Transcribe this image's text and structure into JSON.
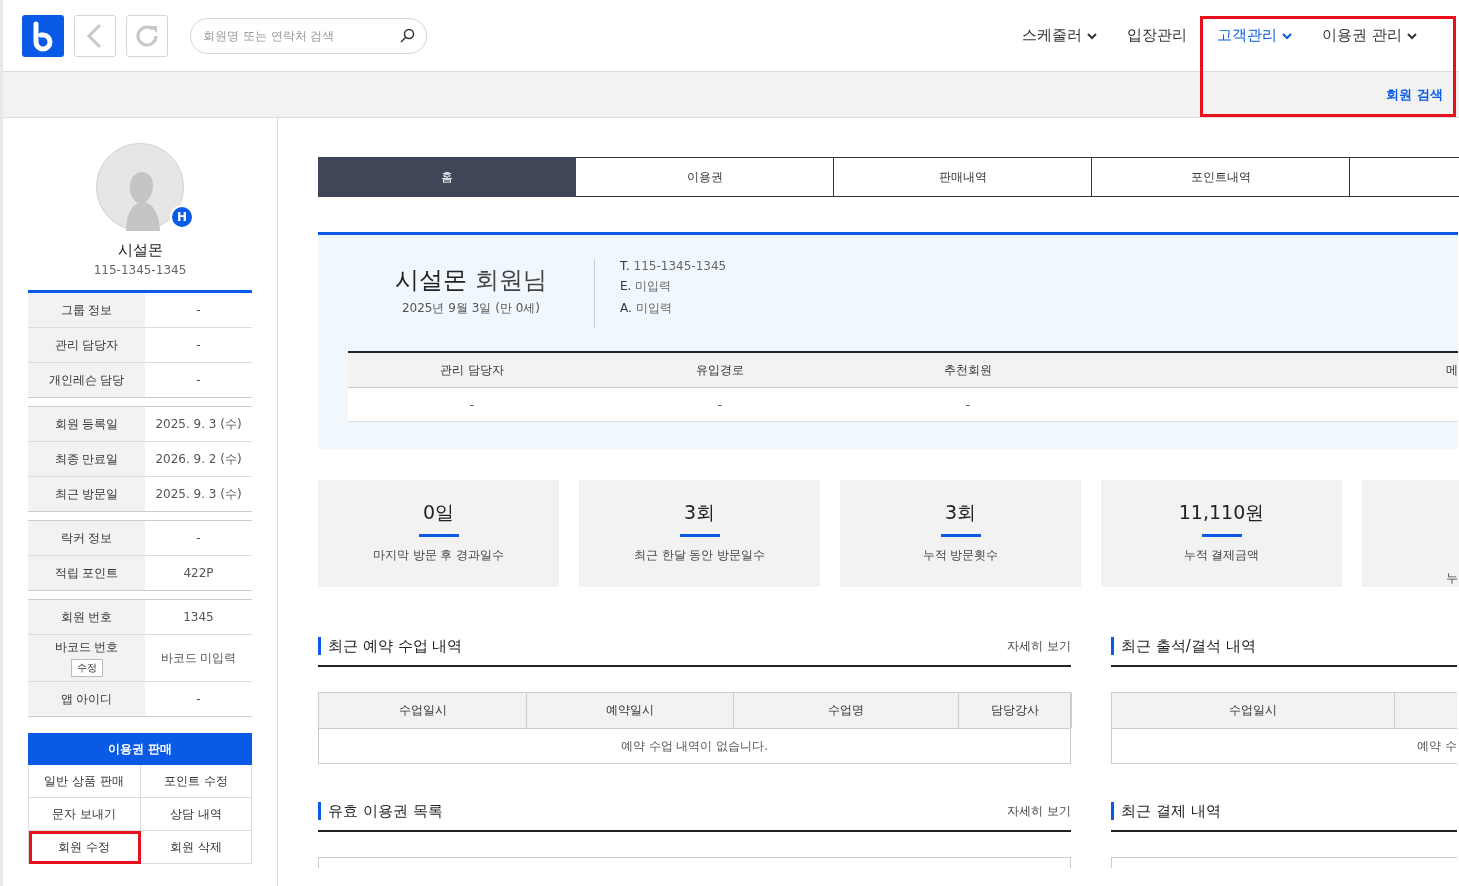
{
  "header": {
    "search": {
      "placeholder": "회원명 또는 연락처 검색"
    },
    "nav": [
      {
        "label": "스케줄러",
        "dropdown": true,
        "selected": false
      },
      {
        "label": "입장관리",
        "dropdown": false,
        "selected": false
      },
      {
        "label": "고객관리",
        "dropdown": true,
        "selected": true
      },
      {
        "label": "이용권 관리",
        "dropdown": true,
        "selected": false
      }
    ],
    "submenu": {
      "highlighted": true,
      "items": [
        {
          "label": "회원 검색",
          "selected": true
        }
      ]
    }
  },
  "member": {
    "badge": "H",
    "name": "시설몬",
    "phone": "115-1345-1345",
    "info_groups": [
      [
        {
          "label": "그룹 정보",
          "value": "-"
        },
        {
          "label": "관리 담당자",
          "value": "-"
        },
        {
          "label": "개인레슨 담당",
          "value": "-"
        }
      ],
      [
        {
          "label": "회원 등록일",
          "value": "2025. 9. 3 (수)"
        },
        {
          "label": "최종 만료일",
          "value": "2026. 9. 2 (수)"
        },
        {
          "label": "최근 방문일",
          "value": "2025. 9. 3 (수)"
        }
      ],
      [
        {
          "label": "락커 정보",
          "value": "-"
        },
        {
          "label": "적립 포인트",
          "value": "422P"
        }
      ],
      [
        {
          "label": "회원 번호",
          "value": "1345"
        },
        {
          "label": "바코드 번호",
          "value": "바코드 미입력",
          "action": "수정"
        },
        {
          "label": "앱 아이디",
          "value": "-"
        }
      ]
    ],
    "primary_action": "이용권 판매",
    "actions": [
      {
        "label": "일반 상품 판매",
        "highlighted": false
      },
      {
        "label": "포인트 수정",
        "highlighted": false
      },
      {
        "label": "문자 보내기",
        "highlighted": false
      },
      {
        "label": "상담 내역",
        "highlighted": false
      },
      {
        "label": "회원 수정",
        "highlighted": true
      },
      {
        "label": "회원 삭제",
        "highlighted": false
      }
    ]
  },
  "tabs": [
    {
      "label": "홈",
      "selected": true
    },
    {
      "label": "이용권",
      "selected": false
    },
    {
      "label": "판매내역",
      "selected": false
    },
    {
      "label": "포인트내역",
      "selected": false
    },
    {
      "selected": false
    }
  ],
  "profile": {
    "name": "시설몬",
    "suffix": "회원님",
    "birth": "2025년 9월 3일 (만 0세)",
    "contacts": [
      {
        "key": "T.",
        "value": "115-1345-1345"
      },
      {
        "key": "E.",
        "value": "미입력"
      },
      {
        "key": "A.",
        "value": "미입력"
      }
    ],
    "columns": [
      "관리 담당자",
      "유입경로",
      "추천회원",
      "메"
    ],
    "values": [
      "-",
      "-",
      "-"
    ]
  },
  "stats": [
    {
      "value": "0일",
      "label": "마지막 방문 후 경과일수"
    },
    {
      "value": "3회",
      "label": "최근 한달 동안 방문일수"
    },
    {
      "value": "3회",
      "label": "누적 방문횟수"
    },
    {
      "value": "11,110원",
      "label": "누적 결제금액"
    },
    {
      "label": "누"
    }
  ],
  "sections": [
    {
      "title": "최근 예약 수업 내역",
      "more": "자세히 보기",
      "columns": [
        "수업일시",
        "예약일시",
        "수업명",
        "담당강사"
      ],
      "empty": "예약 수업 내역이 없습니다."
    },
    {
      "title": "최근 출석/결석 내역",
      "columns": [
        "수업일시"
      ],
      "empty": "예약 수"
    },
    {
      "title": "유효 이용권 목록",
      "more": "자세히 보기"
    },
    {
      "title": "최근 결제 내역"
    }
  ]
}
